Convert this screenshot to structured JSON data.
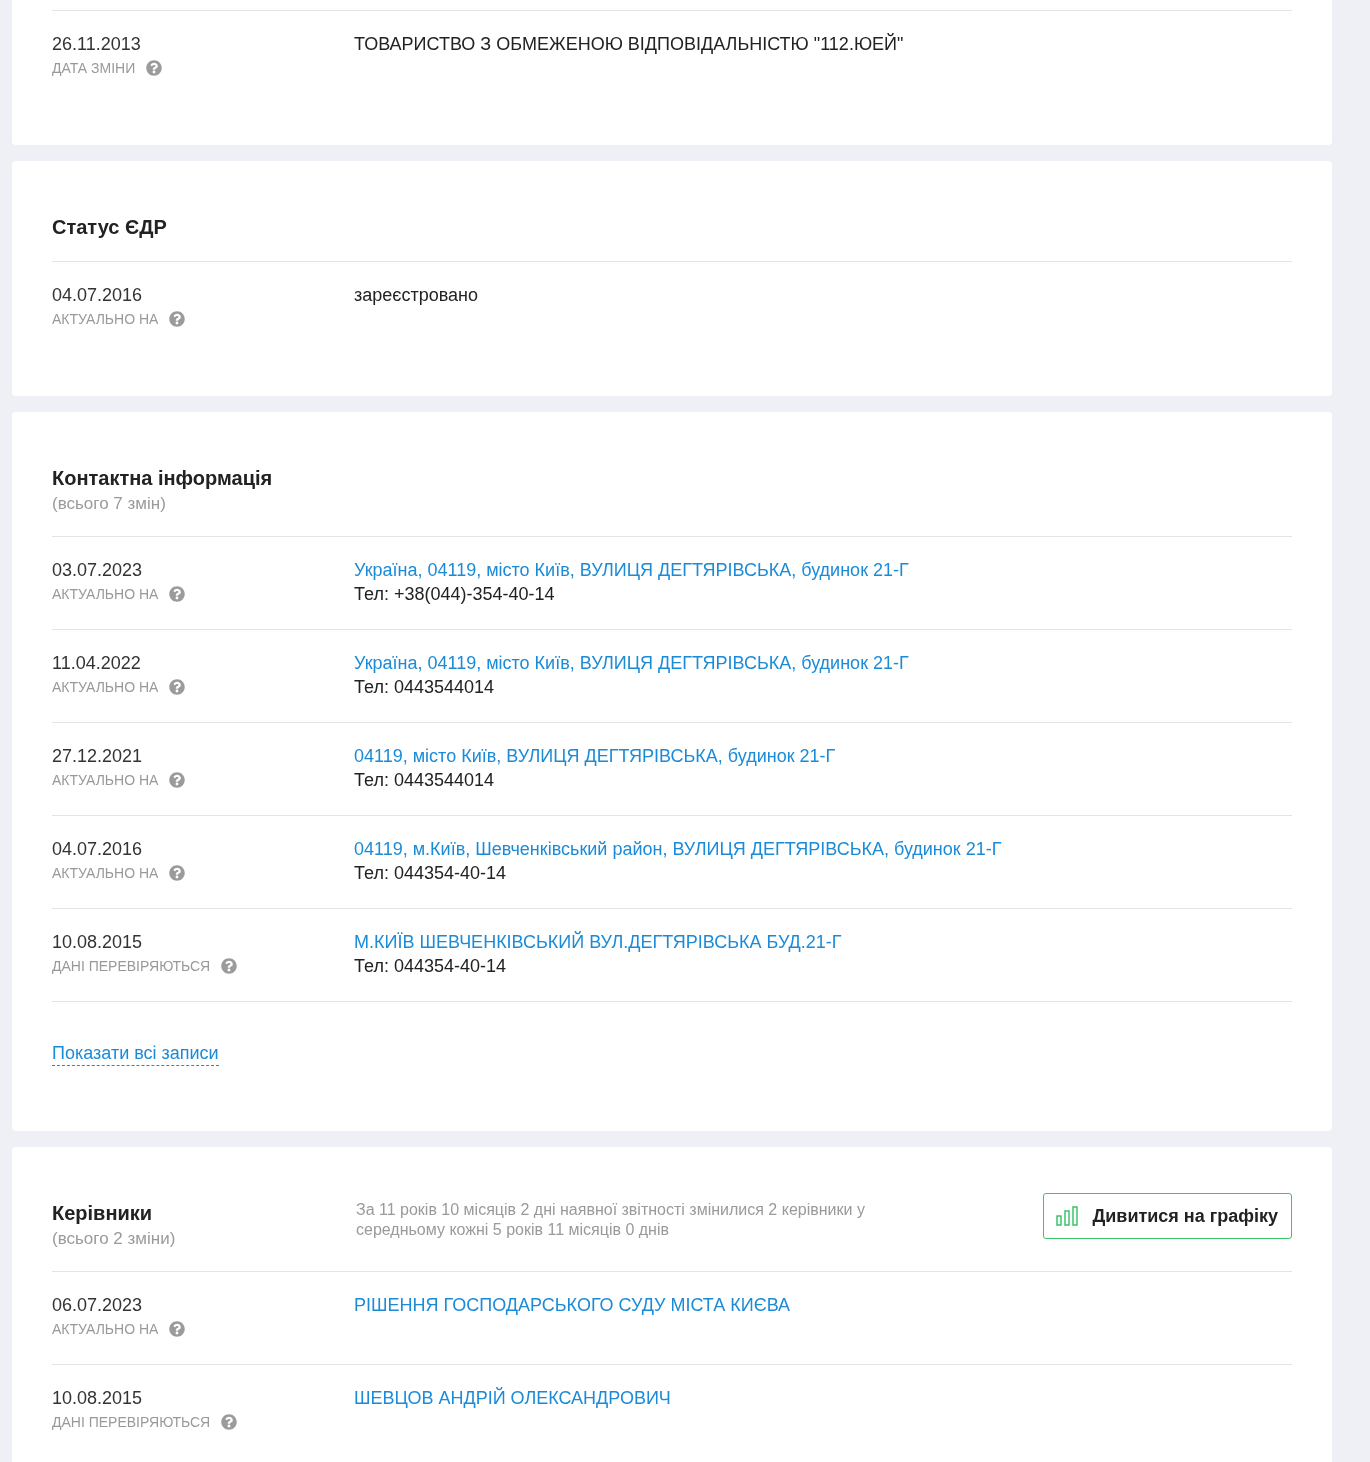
{
  "sections": [
    {
      "rows": [
        {
          "date": "26.11.2013",
          "label": "ДАТА ЗМІНИ",
          "lines": [
            {
              "kind": "text",
              "text": "ТОВАРИСТВО З ОБМЕЖЕНОЮ ВІДПОВІДАЛЬНІСТЮ \"112.ЮЕЙ\""
            }
          ]
        }
      ]
    },
    {
      "title": "Статус ЄДР",
      "rows": [
        {
          "date": "04.07.2016",
          "label": "АКТУАЛЬНО НА",
          "lines": [
            {
              "kind": "text",
              "text": "зареєстровано"
            }
          ]
        }
      ]
    },
    {
      "title": "Контактна інформація",
      "subtitle": "(всього 7 змін)",
      "rows": [
        {
          "date": "03.07.2023",
          "label": "АКТУАЛЬНО НА",
          "lines": [
            {
              "kind": "link",
              "text": "Україна, 04119, місто Київ, ВУЛИЦЯ ДЕГТЯРІВСЬКА, будинок 21-Г"
            },
            {
              "kind": "text",
              "text": "Тел: +38(044)-354-40-14"
            }
          ]
        },
        {
          "date": "11.04.2022",
          "label": "АКТУАЛЬНО НА",
          "lines": [
            {
              "kind": "link",
              "text": "Україна, 04119, місто Київ, ВУЛИЦЯ ДЕГТЯРІВСЬКА, будинок 21-Г"
            },
            {
              "kind": "text",
              "text": "Тел: 0443544014"
            }
          ]
        },
        {
          "date": "27.12.2021",
          "label": "АКТУАЛЬНО НА",
          "lines": [
            {
              "kind": "link",
              "text": "04119, місто Київ, ВУЛИЦЯ ДЕГТЯРІВСЬКА, будинок 21-Г"
            },
            {
              "kind": "text",
              "text": "Тел: 0443544014"
            }
          ]
        },
        {
          "date": "04.07.2016",
          "label": "АКТУАЛЬНО НА",
          "lines": [
            {
              "kind": "link",
              "text": "04119, м.Київ, Шевченківський район, ВУЛИЦЯ ДЕГТЯРІВСЬКА, будинок 21-Г"
            },
            {
              "kind": "text",
              "text": "Тел: 044354-40-14"
            }
          ]
        },
        {
          "date": "10.08.2015",
          "label": "ДАНІ ПЕРЕВІРЯЮТЬСЯ",
          "lines": [
            {
              "kind": "link",
              "text": "М.КИЇВ ШЕВЧЕНКІВСЬКИЙ ВУЛ.ДЕГТЯРІВСЬКА БУД.21-Г"
            },
            {
              "kind": "text",
              "text": "Тел: 044354-40-14"
            }
          ]
        }
      ],
      "show_all": "Показати всі записи"
    },
    {
      "title": "Керівники",
      "subtitle": "(всього 2 зміни)",
      "summary": "За 11 років 10 місяців 2 дні наявної звітності змінилися 2 керівники у середньому кожні 5 років 11 місяців 0 днів",
      "button": "Дивитися на графіку",
      "rows": [
        {
          "date": "06.07.2023",
          "label": "АКТУАЛЬНО НА",
          "lines": [
            {
              "kind": "link",
              "text": "РІШЕННЯ ГОСПОДАРСЬКОГО СУДУ МІСТА КИЄВА"
            }
          ]
        },
        {
          "date": "10.08.2015",
          "label": "ДАНІ ПЕРЕВІРЯЮТЬСЯ",
          "lines": [
            {
              "kind": "link",
              "text": "ШЕВЦОВ АНДРІЙ ОЛЕКСАНДРОВИЧ"
            }
          ]
        }
      ]
    }
  ]
}
